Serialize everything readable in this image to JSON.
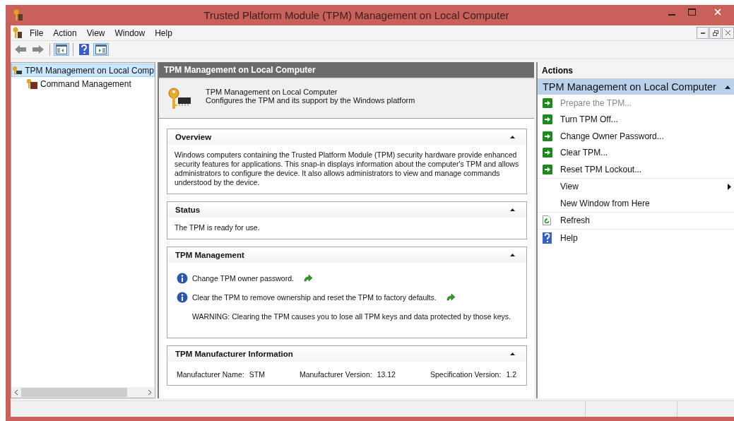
{
  "window": {
    "title": "Trusted Platform Module (TPM) Management on Local Computer"
  },
  "menu": [
    "File",
    "Action",
    "View",
    "Window",
    "Help"
  ],
  "tree": [
    {
      "label": "TPM Management on Local Comp",
      "selected": true,
      "children": [
        {
          "label": "Command Management",
          "selected": false
        }
      ]
    }
  ],
  "center": {
    "header": "TPM Management on Local Computer",
    "info_title": "TPM Management on Local Computer",
    "info_description": "Configures the TPM and its support by the Windows platform",
    "sections": [
      {
        "title": "Overview",
        "expanded": true,
        "kind": "text",
        "text": "Windows computers containing the Trusted Platform Module (TPM) security hardware provide enhanced security features for applications. This snap-in displays information about the computer's TPM and allows administrators to configure the device. It also allows administrators to view and manage commands understood by the device."
      },
      {
        "title": "Status",
        "expanded": true,
        "kind": "text",
        "text": "The TPM is ready for use."
      },
      {
        "title": "TPM Management",
        "expanded": true,
        "kind": "tasks",
        "items": [
          {
            "kind": "link",
            "text": "Change TPM owner password."
          },
          {
            "kind": "link",
            "text": "Clear the TPM to remove ownership and reset the TPM to factory defaults."
          },
          {
            "kind": "warning",
            "text": "WARNING: Clearing the TPM causes you to lose all TPM keys and data protected by those keys."
          }
        ]
      },
      {
        "title": "TPM Manufacturer Information",
        "expanded": true,
        "kind": "fields",
        "fields": [
          {
            "label": "Manufacturer Name:",
            "value": "STM"
          },
          {
            "label": "Manufacturer Version:",
            "value": "13.12"
          },
          {
            "label": "Specification Version:",
            "value": "1.2"
          }
        ]
      }
    ]
  },
  "actions": {
    "header": "Actions",
    "group": "TPM Management on Local Computer",
    "expanded": true,
    "items": [
      {
        "kind": "action",
        "label": "Prepare the TPM...",
        "disabled": true
      },
      {
        "kind": "action",
        "label": "Turn TPM Off...",
        "disabled": false
      },
      {
        "kind": "action",
        "label": "Change Owner Password...",
        "disabled": false
      },
      {
        "kind": "action",
        "label": "Clear TPM...",
        "disabled": false
      },
      {
        "kind": "action",
        "label": "Reset TPM Lockout...",
        "disabled": false
      },
      {
        "kind": "submenu",
        "label": "View",
        "disabled": false
      },
      {
        "kind": "plain",
        "label": "New Window from Here",
        "disabled": false
      },
      {
        "kind": "refresh",
        "label": "Refresh",
        "disabled": false
      },
      {
        "kind": "help",
        "label": "Help",
        "disabled": false
      }
    ]
  }
}
